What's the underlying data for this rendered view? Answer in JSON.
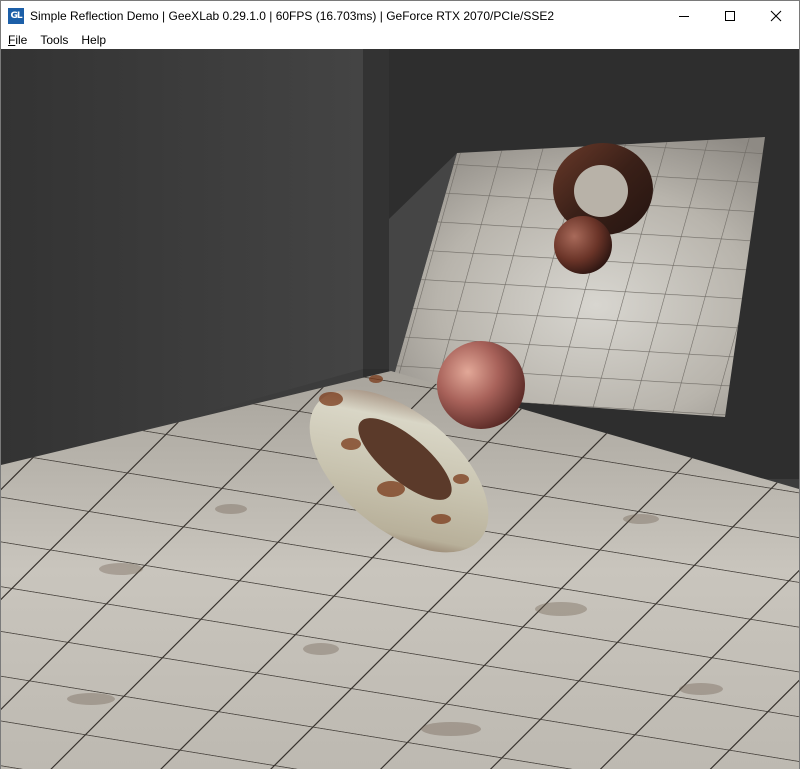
{
  "window": {
    "title": "Simple Reflection Demo | GeeXLab 0.29.1.0 | 60FPS (16.703ms) | GeForce RTX 2070/PCIe/SSE2",
    "app_icon_text": "GL",
    "controls": {
      "minimize_icon": "minimize-icon",
      "maximize_icon": "maximize-icon",
      "close_icon": "close-icon"
    }
  },
  "menu": {
    "items": [
      {
        "accel": "F",
        "rest": "ile"
      },
      {
        "accel": "",
        "rest": "Tools"
      },
      {
        "accel": "",
        "rest": "Help"
      }
    ]
  },
  "scene": {
    "background_color": "#3b3b3b",
    "back_wall_color": "#2f2f2f",
    "floor_color": "#c8c4bc",
    "grout_color": "#3a3530",
    "torus_color": "#c9c4b2",
    "rust_color": "#7a3a1a",
    "sphere_color": "#b06a5a"
  }
}
